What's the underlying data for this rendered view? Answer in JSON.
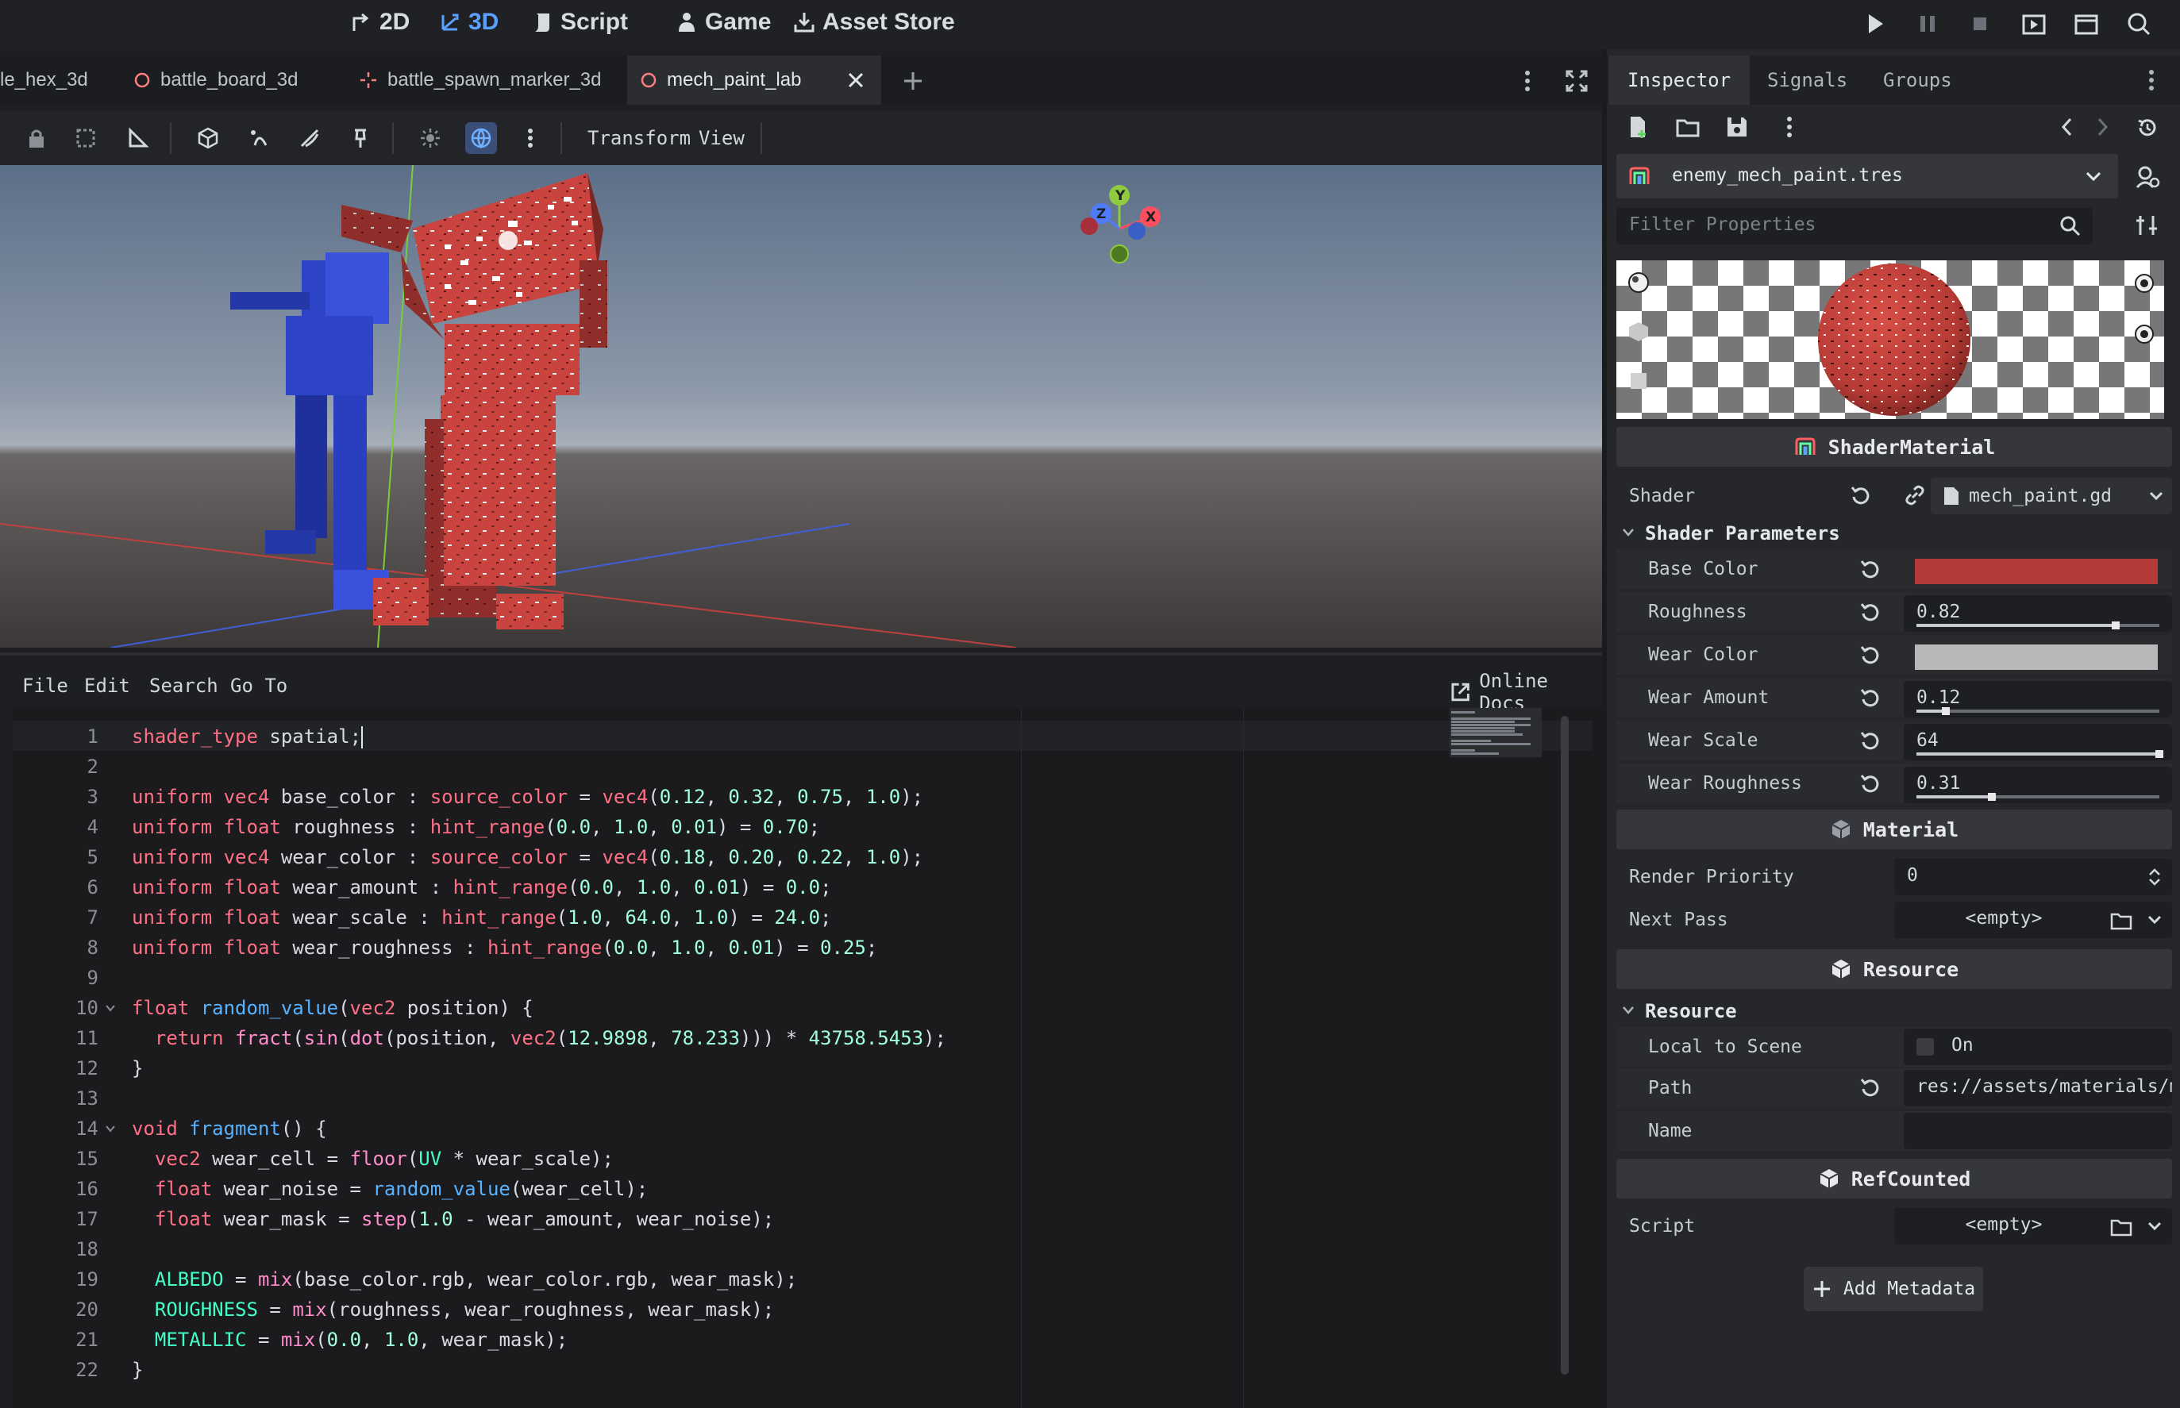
{
  "topbar": {
    "modes": [
      {
        "label": "2D",
        "icon": "2d-icon"
      },
      {
        "label": "3D",
        "icon": "3d-icon"
      },
      {
        "label": "Script",
        "icon": "script-icon"
      },
      {
        "label": "Game",
        "icon": "game-icon"
      },
      {
        "label": "Asset Store",
        "icon": "asset-store-icon"
      }
    ],
    "active_mode": "3D"
  },
  "scene_tabs": [
    {
      "label": "le_hex_3d"
    },
    {
      "label": "battle_board_3d"
    },
    {
      "label": "battle_spawn_marker_3d"
    },
    {
      "label": "mech_paint_lab",
      "active": true
    }
  ],
  "viewport_toolbar": {
    "transform_label": "Transform",
    "view_label": "View"
  },
  "gizmo": {
    "x": "X",
    "y": "Y",
    "z": "Z"
  },
  "editor_menu": {
    "file": "File",
    "edit": "Edit",
    "search": "Search",
    "goto": "Go To",
    "online_docs": "Online Docs"
  },
  "code_lines": [
    "shader_type spatial;",
    "",
    "uniform vec4 base_color : source_color = vec4(0.12, 0.32, 0.75, 1.0);",
    "uniform float roughness : hint_range(0.0, 1.0, 0.01) = 0.70;",
    "uniform vec4 wear_color : source_color = vec4(0.18, 0.20, 0.22, 1.0);",
    "uniform float wear_amount : hint_range(0.0, 1.0, 0.01) = 0.0;",
    "uniform float wear_scale : hint_range(1.0, 64.0, 1.0) = 24.0;",
    "uniform float wear_roughness : hint_range(0.0, 1.0, 0.01) = 0.25;",
    "",
    "float random_value(vec2 position) {",
    "  return fract(sin(dot(position, vec2(12.9898, 78.233))) * 43758.5453);",
    "}",
    "",
    "void fragment() {",
    "  vec2 wear_cell = floor(UV * wear_scale);",
    "  float wear_noise = random_value(wear_cell);",
    "  float wear_mask = step(1.0 - wear_amount, wear_noise);",
    "",
    "  ALBEDO = mix(base_color.rgb, wear_color.rgb, wear_mask);",
    "  ROUGHNESS = mix(roughness, wear_roughness, wear_mask);",
    "  METALLIC = mix(0.0, 1.0, wear_mask);",
    "}"
  ],
  "inspector": {
    "tabs": [
      "Inspector",
      "Signals",
      "Groups"
    ],
    "resource_file": "enemy_mech_paint.tres",
    "filter_placeholder": "Filter Properties",
    "shader_material_title": "ShaderMaterial",
    "shader_label": "Shader",
    "shader_value": "mech_paint.gd",
    "shader_params_title": "Shader Parameters",
    "params": [
      {
        "label": "Base Color",
        "type": "color",
        "color": "#b23b37"
      },
      {
        "label": "Roughness",
        "type": "slider",
        "value": "0.82",
        "fraction": 0.82
      },
      {
        "label": "Wear Color",
        "type": "color",
        "color": "#b8b8b8"
      },
      {
        "label": "Wear Amount",
        "type": "slider",
        "value": "0.12",
        "fraction": 0.12
      },
      {
        "label": "Wear Scale",
        "type": "slider",
        "value": "64",
        "fraction": 1.0
      },
      {
        "label": "Wear Roughness",
        "type": "slider",
        "value": "0.31",
        "fraction": 0.31
      }
    ],
    "material_title": "Material",
    "render_priority_label": "Render Priority",
    "render_priority_value": "0",
    "next_pass_label": "Next Pass",
    "next_pass_value": "<empty>",
    "resource_title": "Resource",
    "resource_group": "Resource",
    "local_to_scene_label": "Local to Scene",
    "local_to_scene_value": "On",
    "path_label": "Path",
    "path_value": "res://assets/materials/me",
    "name_label": "Name",
    "refcounted_title": "RefCounted",
    "script_label": "Script",
    "script_value": "<empty>",
    "add_metadata": "Add Metadata"
  }
}
